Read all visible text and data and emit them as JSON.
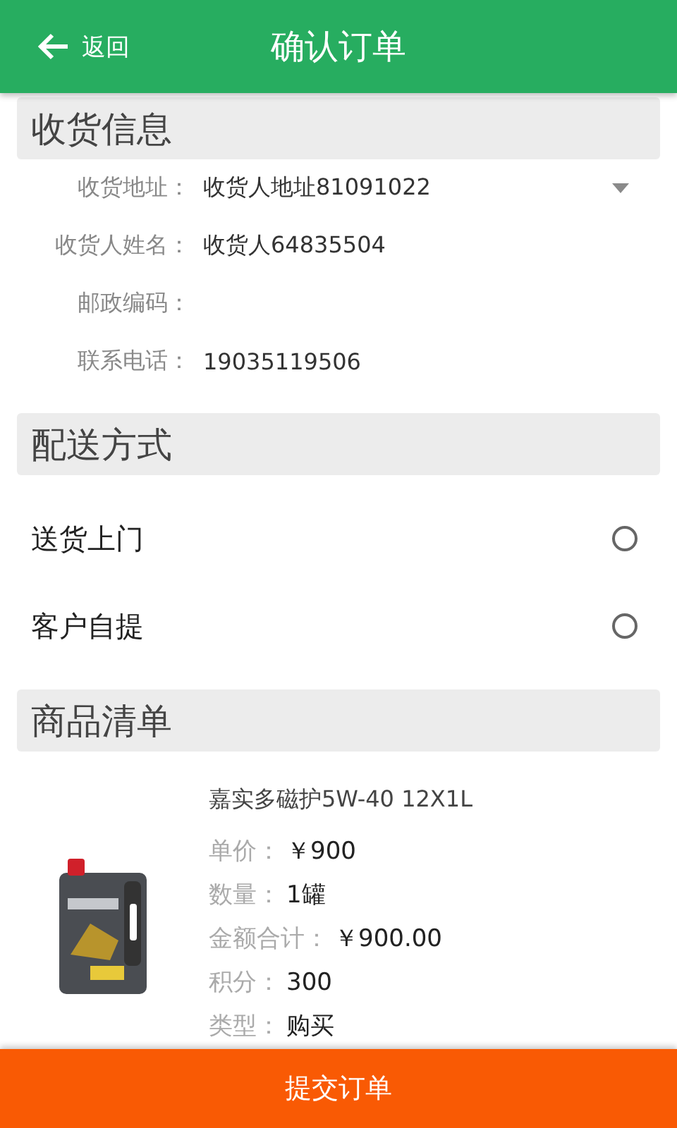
{
  "header": {
    "back": "返回",
    "title": "确认订单"
  },
  "receiver": {
    "title": "收货信息",
    "fields": [
      {
        "label": "收货地址：",
        "value": "收货人地址81091022",
        "dropdown": true
      },
      {
        "label": "收货人姓名：",
        "value": "收货人64835504",
        "dropdown": false
      },
      {
        "label": "邮政编码：",
        "dropdown": false
      },
      {
        "label": "联系电话：",
        "value": "19035119506",
        "dropdown": false
      }
    ]
  },
  "delivery": {
    "title": "配送方式",
    "options": [
      {
        "label": "送货上门",
        "selected": false
      },
      {
        "label": "客户自提",
        "selected": false
      }
    ]
  },
  "goods": {
    "title": "商品清单",
    "items": [
      {
        "name": "嘉实多磁护5W-40 12X1L",
        "details": [
          {
            "label": "单价：",
            "value": "￥900"
          },
          {
            "label": "数量：",
            "value": "1罐"
          },
          {
            "label": "金额合计：",
            "value": "￥900.00"
          },
          {
            "label": "积分：",
            "value": "300"
          },
          {
            "label": "类型：",
            "value": "购买"
          }
        ]
      }
    ]
  },
  "submit": "提交订单"
}
